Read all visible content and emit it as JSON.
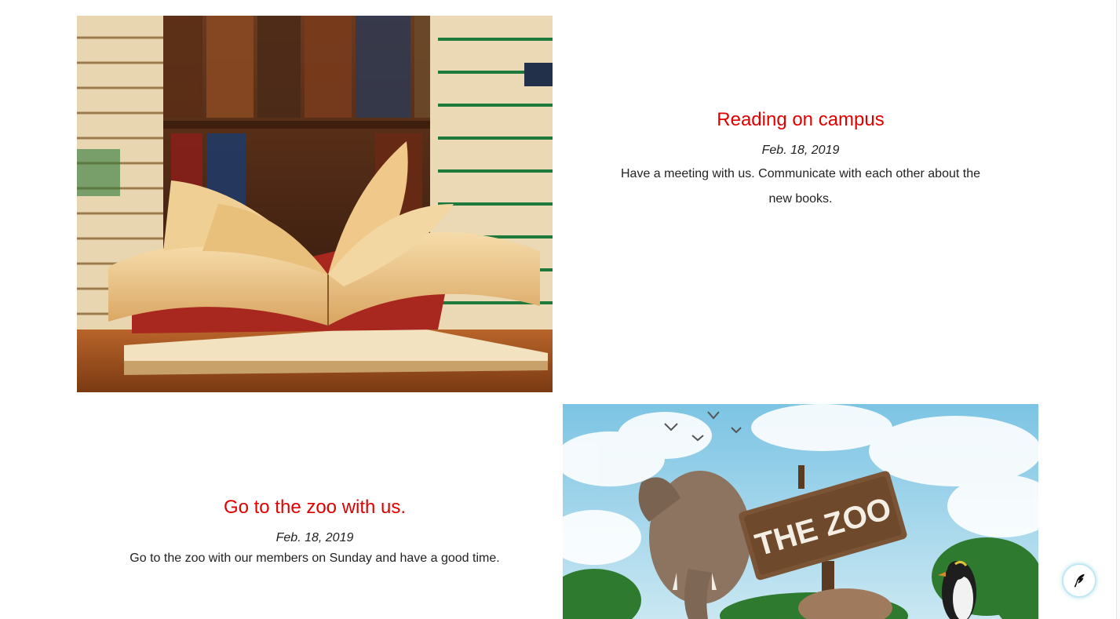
{
  "posts": [
    {
      "image_subject": "open-books-on-library-table",
      "title": "Reading on campus",
      "date": "Feb. 18, 2019",
      "description": "Have a meeting with us. Communicate with each other about the new books."
    },
    {
      "image_subject": "zoo-elephant-and-wooden-sign",
      "title": "Go to the zoo with us.",
      "date": "Feb. 18, 2019",
      "description": "Go to the zoo with our members on Sunday and have a good time."
    }
  ],
  "zoo_sign_text": "THE ZOO",
  "floating_button": {
    "icon": "bird-feather-icon"
  },
  "colors": {
    "title_red": "#e00000",
    "text": "#222222",
    "fab_border": "#bde9f2"
  }
}
